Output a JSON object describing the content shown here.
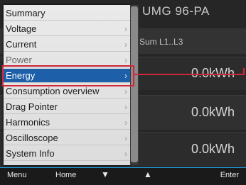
{
  "device": {
    "title": "UMG 96-PA",
    "subtitle": "Sum L1..L3",
    "values": [
      "0.0kWh",
      "0.0kWh",
      "0.0kWh"
    ]
  },
  "menu": {
    "items": [
      {
        "label": "Summary",
        "chevron": ""
      },
      {
        "label": "Voltage",
        "chevron": "›"
      },
      {
        "label": "Current",
        "chevron": "›"
      },
      {
        "label": "Power",
        "chevron": "›"
      },
      {
        "label": "Energy",
        "chevron": "›"
      },
      {
        "label": "Consumption overview",
        "chevron": "›"
      },
      {
        "label": "Drag Pointer",
        "chevron": "›"
      },
      {
        "label": "Harmonics",
        "chevron": "›"
      },
      {
        "label": "Oscilloscope",
        "chevron": "›"
      },
      {
        "label": "System Info",
        "chevron": "›"
      }
    ],
    "active_index": 4
  },
  "softkeys": {
    "menu": "Menu",
    "home": "Home",
    "down": "▼",
    "up": "▲",
    "enter": "Enter"
  },
  "colors": {
    "highlight": "#d0283c",
    "active": "#1d5fa8",
    "softbar_accent": "#1aa0e0"
  }
}
